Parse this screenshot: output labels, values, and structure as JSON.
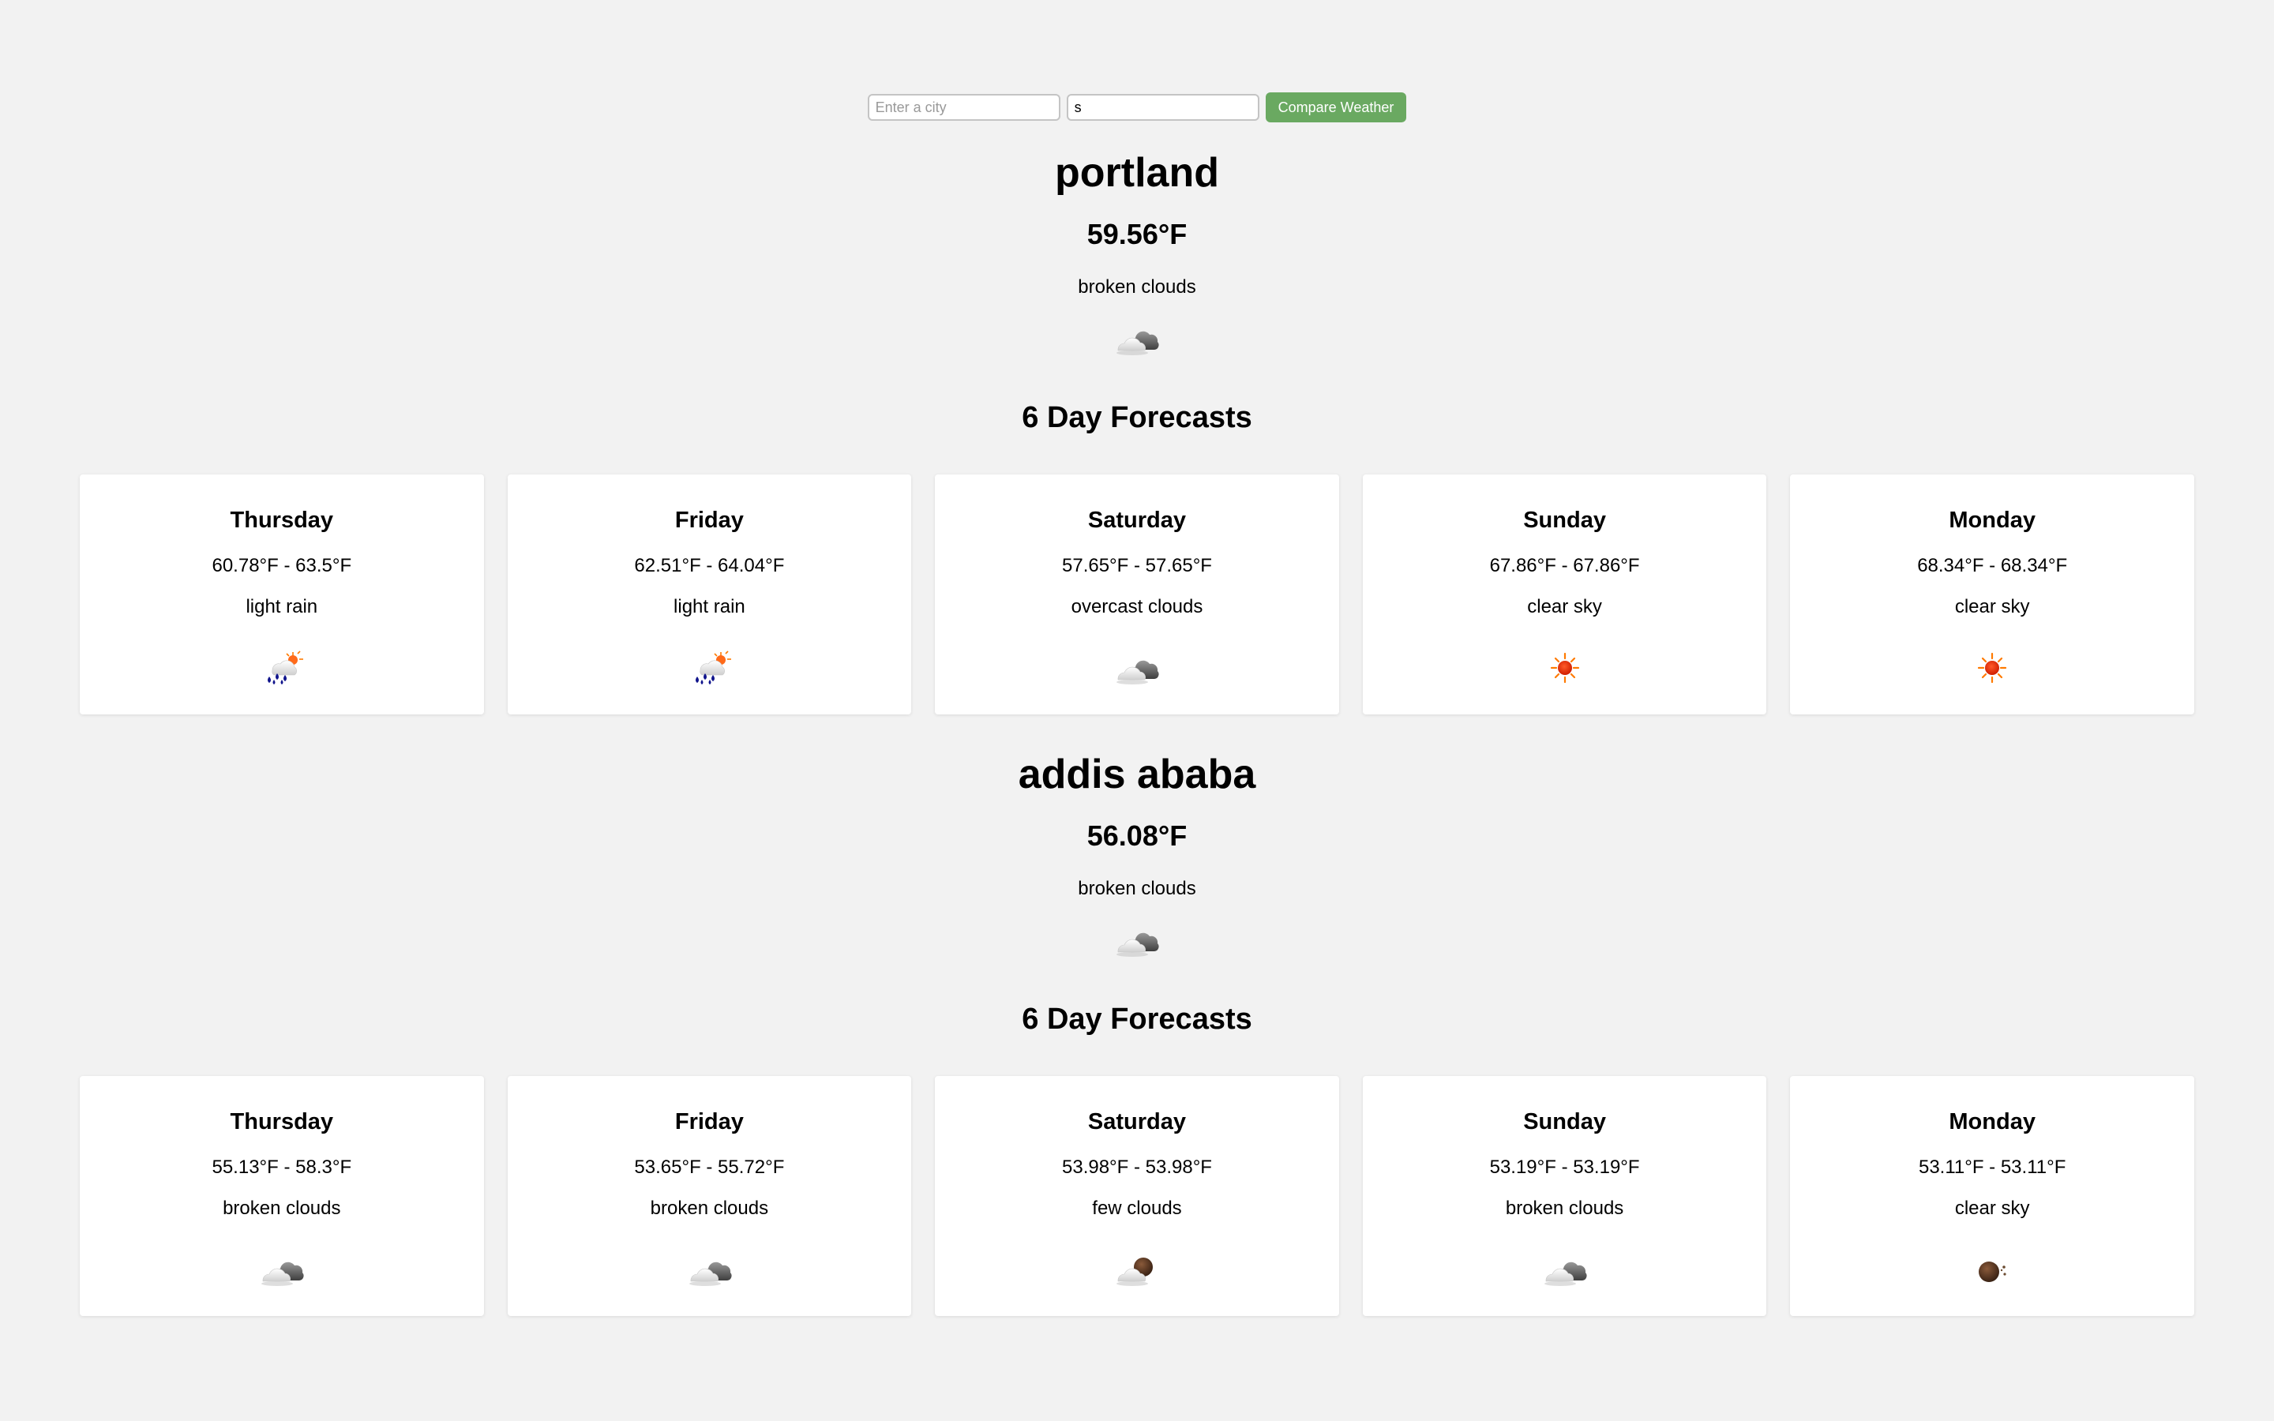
{
  "search": {
    "city1_value": "",
    "city1_placeholder": "Enter a city",
    "city2_value": "s",
    "city2_placeholder": "",
    "button_label": "Compare Weather"
  },
  "colors": {
    "background": "#f2f2f2",
    "button": "#6aa961",
    "card": "#ffffff"
  },
  "cities": [
    {
      "name": "portland",
      "temperature": "59.56°F",
      "description": "broken clouds",
      "icon": "broken-clouds-icon",
      "forecast_title": "6 Day Forecasts",
      "forecast": [
        {
          "day": "Thursday",
          "range": "60.78°F - 63.5°F",
          "description": "light rain",
          "icon": "rain-icon"
        },
        {
          "day": "Friday",
          "range": "62.51°F - 64.04°F",
          "description": "light rain",
          "icon": "rain-icon"
        },
        {
          "day": "Saturday",
          "range": "57.65°F - 57.65°F",
          "description": "overcast clouds",
          "icon": "broken-clouds-icon"
        },
        {
          "day": "Sunday",
          "range": "67.86°F - 67.86°F",
          "description": "clear sky",
          "icon": "sun-icon"
        },
        {
          "day": "Monday",
          "range": "68.34°F - 68.34°F",
          "description": "clear sky",
          "icon": "sun-icon"
        }
      ]
    },
    {
      "name": "addis ababa",
      "temperature": "56.08°F",
      "description": "broken clouds",
      "icon": "broken-clouds-icon",
      "forecast_title": "6 Day Forecasts",
      "forecast": [
        {
          "day": "Thursday",
          "range": "55.13°F - 58.3°F",
          "description": "broken clouds",
          "icon": "broken-clouds-icon"
        },
        {
          "day": "Friday",
          "range": "53.65°F - 55.72°F",
          "description": "broken clouds",
          "icon": "broken-clouds-icon"
        },
        {
          "day": "Saturday",
          "range": "53.98°F - 53.98°F",
          "description": "few clouds",
          "icon": "few-clouds-night-icon"
        },
        {
          "day": "Sunday",
          "range": "53.19°F - 53.19°F",
          "description": "broken clouds",
          "icon": "broken-clouds-icon"
        },
        {
          "day": "Monday",
          "range": "53.11°F - 53.11°F",
          "description": "clear sky",
          "icon": "moon-icon"
        }
      ]
    }
  ]
}
